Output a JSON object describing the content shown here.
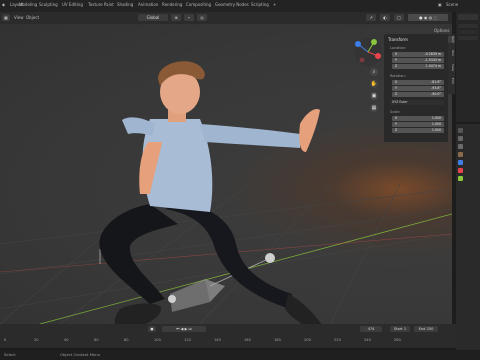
{
  "workspace_tabs": [
    "Layout",
    "Modeling",
    "Sculpting",
    "UV Editing",
    "Texture Paint",
    "Shading",
    "Animation",
    "Rendering",
    "Compositing",
    "Geometry Nodes",
    "Scripting"
  ],
  "active_tab": "Layout",
  "add_tab": "+",
  "scene_label": "Scene",
  "header": {
    "menu_view": "View",
    "menu_object": "Object",
    "orientation": "Global",
    "options": "Options"
  },
  "n_panel": {
    "title": "Transform",
    "location_label": "Location:",
    "location": [
      {
        "axis": "X",
        "value": "-0.2839 m"
      },
      {
        "axis": "Y",
        "value": "-1.5343 m"
      },
      {
        "axis": "Z",
        "value": "1.0474 m"
      }
    ],
    "rotation_label": "Rotation:",
    "rotation": [
      {
        "axis": "X",
        "value": "-81.6°"
      },
      {
        "axis": "Y",
        "value": "-93.8°"
      },
      {
        "axis": "Z",
        "value": "-90.0°"
      }
    ],
    "rotation_mode": "XYZ Euler",
    "scale_label": "Scale:",
    "scale": [
      {
        "axis": "X",
        "value": "1.000"
      },
      {
        "axis": "Y",
        "value": "1.000"
      },
      {
        "axis": "Z",
        "value": "1.000"
      }
    ]
  },
  "side_tabs": [
    "Item",
    "Tool",
    "View",
    "Edit"
  ],
  "timeline": {
    "frame_numbers": [
      "0",
      "20",
      "40",
      "60",
      "80",
      "100",
      "120",
      "140",
      "160",
      "180",
      "200",
      "220",
      "240",
      "260"
    ],
    "current_frame": "474",
    "start_label": "Start",
    "start_value": "1",
    "end_label": "End",
    "end_value": "250"
  },
  "status": {
    "left": "Select",
    "middle": "Object Context Menu"
  },
  "colors": {
    "accent": "#4772b3",
    "x_axis": "#e8434c",
    "y_axis": "#8ac73c",
    "z_axis": "#3f7ee8"
  }
}
